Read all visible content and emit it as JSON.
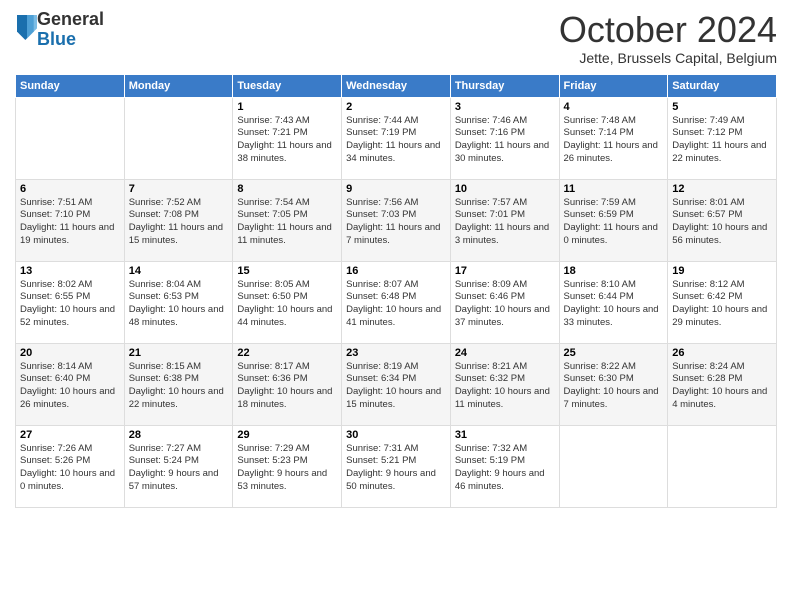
{
  "logo": {
    "general": "General",
    "blue": "Blue"
  },
  "header": {
    "month": "October 2024",
    "location": "Jette, Brussels Capital, Belgium"
  },
  "days": [
    "Sunday",
    "Monday",
    "Tuesday",
    "Wednesday",
    "Thursday",
    "Friday",
    "Saturday"
  ],
  "weeks": [
    [
      {
        "day": "",
        "info": ""
      },
      {
        "day": "",
        "info": ""
      },
      {
        "day": "1",
        "info": "Sunrise: 7:43 AM\nSunset: 7:21 PM\nDaylight: 11 hours and 38 minutes."
      },
      {
        "day": "2",
        "info": "Sunrise: 7:44 AM\nSunset: 7:19 PM\nDaylight: 11 hours and 34 minutes."
      },
      {
        "day": "3",
        "info": "Sunrise: 7:46 AM\nSunset: 7:16 PM\nDaylight: 11 hours and 30 minutes."
      },
      {
        "day": "4",
        "info": "Sunrise: 7:48 AM\nSunset: 7:14 PM\nDaylight: 11 hours and 26 minutes."
      },
      {
        "day": "5",
        "info": "Sunrise: 7:49 AM\nSunset: 7:12 PM\nDaylight: 11 hours and 22 minutes."
      }
    ],
    [
      {
        "day": "6",
        "info": "Sunrise: 7:51 AM\nSunset: 7:10 PM\nDaylight: 11 hours and 19 minutes."
      },
      {
        "day": "7",
        "info": "Sunrise: 7:52 AM\nSunset: 7:08 PM\nDaylight: 11 hours and 15 minutes."
      },
      {
        "day": "8",
        "info": "Sunrise: 7:54 AM\nSunset: 7:05 PM\nDaylight: 11 hours and 11 minutes."
      },
      {
        "day": "9",
        "info": "Sunrise: 7:56 AM\nSunset: 7:03 PM\nDaylight: 11 hours and 7 minutes."
      },
      {
        "day": "10",
        "info": "Sunrise: 7:57 AM\nSunset: 7:01 PM\nDaylight: 11 hours and 3 minutes."
      },
      {
        "day": "11",
        "info": "Sunrise: 7:59 AM\nSunset: 6:59 PM\nDaylight: 11 hours and 0 minutes."
      },
      {
        "day": "12",
        "info": "Sunrise: 8:01 AM\nSunset: 6:57 PM\nDaylight: 10 hours and 56 minutes."
      }
    ],
    [
      {
        "day": "13",
        "info": "Sunrise: 8:02 AM\nSunset: 6:55 PM\nDaylight: 10 hours and 52 minutes."
      },
      {
        "day": "14",
        "info": "Sunrise: 8:04 AM\nSunset: 6:53 PM\nDaylight: 10 hours and 48 minutes."
      },
      {
        "day": "15",
        "info": "Sunrise: 8:05 AM\nSunset: 6:50 PM\nDaylight: 10 hours and 44 minutes."
      },
      {
        "day": "16",
        "info": "Sunrise: 8:07 AM\nSunset: 6:48 PM\nDaylight: 10 hours and 41 minutes."
      },
      {
        "day": "17",
        "info": "Sunrise: 8:09 AM\nSunset: 6:46 PM\nDaylight: 10 hours and 37 minutes."
      },
      {
        "day": "18",
        "info": "Sunrise: 8:10 AM\nSunset: 6:44 PM\nDaylight: 10 hours and 33 minutes."
      },
      {
        "day": "19",
        "info": "Sunrise: 8:12 AM\nSunset: 6:42 PM\nDaylight: 10 hours and 29 minutes."
      }
    ],
    [
      {
        "day": "20",
        "info": "Sunrise: 8:14 AM\nSunset: 6:40 PM\nDaylight: 10 hours and 26 minutes."
      },
      {
        "day": "21",
        "info": "Sunrise: 8:15 AM\nSunset: 6:38 PM\nDaylight: 10 hours and 22 minutes."
      },
      {
        "day": "22",
        "info": "Sunrise: 8:17 AM\nSunset: 6:36 PM\nDaylight: 10 hours and 18 minutes."
      },
      {
        "day": "23",
        "info": "Sunrise: 8:19 AM\nSunset: 6:34 PM\nDaylight: 10 hours and 15 minutes."
      },
      {
        "day": "24",
        "info": "Sunrise: 8:21 AM\nSunset: 6:32 PM\nDaylight: 10 hours and 11 minutes."
      },
      {
        "day": "25",
        "info": "Sunrise: 8:22 AM\nSunset: 6:30 PM\nDaylight: 10 hours and 7 minutes."
      },
      {
        "day": "26",
        "info": "Sunrise: 8:24 AM\nSunset: 6:28 PM\nDaylight: 10 hours and 4 minutes."
      }
    ],
    [
      {
        "day": "27",
        "info": "Sunrise: 7:26 AM\nSunset: 5:26 PM\nDaylight: 10 hours and 0 minutes."
      },
      {
        "day": "28",
        "info": "Sunrise: 7:27 AM\nSunset: 5:24 PM\nDaylight: 9 hours and 57 minutes."
      },
      {
        "day": "29",
        "info": "Sunrise: 7:29 AM\nSunset: 5:23 PM\nDaylight: 9 hours and 53 minutes."
      },
      {
        "day": "30",
        "info": "Sunrise: 7:31 AM\nSunset: 5:21 PM\nDaylight: 9 hours and 50 minutes."
      },
      {
        "day": "31",
        "info": "Sunrise: 7:32 AM\nSunset: 5:19 PM\nDaylight: 9 hours and 46 minutes."
      },
      {
        "day": "",
        "info": ""
      },
      {
        "day": "",
        "info": ""
      }
    ]
  ]
}
